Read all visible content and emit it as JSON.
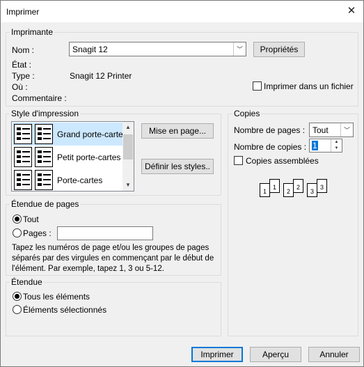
{
  "window": {
    "title": "Imprimer",
    "close_glyph": "✕"
  },
  "printer": {
    "group_label": "Imprimante",
    "name_label": "Nom :",
    "name_value": "Snagit 12",
    "properties_button": "Propriétés",
    "status_label": "État :",
    "status_value": "",
    "type_label": "Type :",
    "type_value": "Snagit 12 Printer",
    "where_label": "Où :",
    "where_value": "",
    "comment_label": "Commentaire :",
    "comment_value": "",
    "print_to_file_label": "Imprimer dans un fichier",
    "print_to_file_checked": false
  },
  "print_style": {
    "group_label": "Style d'impression",
    "items": [
      {
        "label": "Grand porte-cartes",
        "selected": true
      },
      {
        "label": "Petit porte-cartes",
        "selected": false
      },
      {
        "label": "Porte-cartes",
        "selected": false
      }
    ],
    "page_setup_button": "Mise en page...",
    "define_styles_button": "Définir les styles.."
  },
  "copies": {
    "group_label": "Copies",
    "pages_label": "Nombre de pages :",
    "pages_value": "Tout",
    "count_label": "Nombre de copies :",
    "count_value": "1",
    "collate_label": "Copies assemblées",
    "collate_checked": false,
    "illustration": [
      "1",
      "1",
      "2",
      "2",
      "3",
      "3"
    ]
  },
  "page_range": {
    "group_label": "Étendue de pages",
    "all_label": "Tout",
    "all_selected": true,
    "pages_label": "Pages :",
    "pages_value": "",
    "description": "Tapez les numéros de page et/ou les groupes de pages séparés par des virgules en commençant par le début de l'élément. Par exemple, tapez 1, 3 ou 5-12."
  },
  "range": {
    "group_label": "Étendue",
    "all_items_label": "Tous les éléments",
    "all_items_selected": true,
    "selected_items_label": "Éléments sélectionnés"
  },
  "footer": {
    "print_button": "Imprimer",
    "preview_button": "Aperçu",
    "cancel_button": "Annuler"
  }
}
